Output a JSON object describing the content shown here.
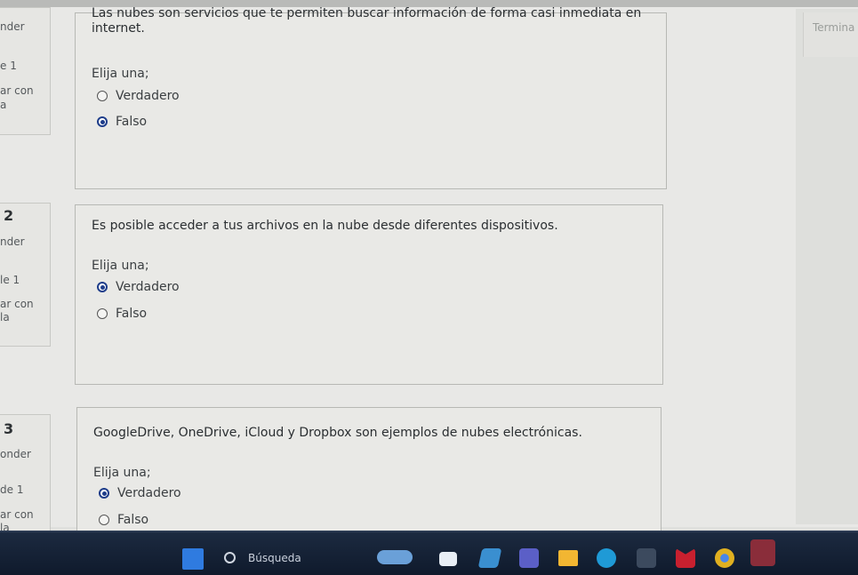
{
  "header": {
    "finish_label": "Termina"
  },
  "questions": [
    {
      "info": {
        "number": "",
        "state": "nder",
        "mark": "e 1",
        "flag": "ar con",
        "flag2": "a"
      },
      "text": "Las nubes son servicios que te permiten buscar información de forma casi inmediata en internet.",
      "prompt": "Elija una;",
      "options": [
        {
          "label": "Verdadero",
          "checked": false
        },
        {
          "label": "Falso",
          "checked": true
        }
      ]
    },
    {
      "info": {
        "number": "2",
        "state": "nder",
        "mark": "le 1",
        "flag": "ar con",
        "flag2": "la"
      },
      "text": "Es posible acceder a tus archivos en la nube desde diferentes dispositivos.",
      "prompt": "Elija una;",
      "options": [
        {
          "label": "Verdadero",
          "checked": true
        },
        {
          "label": "Falso",
          "checked": false
        }
      ]
    },
    {
      "info": {
        "number": "3",
        "state": "onder",
        "mark": "de 1",
        "flag": "ar con",
        "flag2": "la"
      },
      "text": "GoogleDrive, OneDrive, iCloud y Dropbox son ejemplos de nubes electrónicas.",
      "prompt": "Elija una;",
      "options": [
        {
          "label": "Verdadero",
          "checked": true
        },
        {
          "label": "Falso",
          "checked": false
        }
      ]
    }
  ],
  "taskbar": {
    "search_label": "Búsqueda",
    "icons": [
      {
        "name": "start-icon",
        "color": "#2f7be0"
      },
      {
        "name": "widgets-icon",
        "color": "#6aa0d8"
      },
      {
        "name": "file-icon",
        "color": "#e8eef5"
      },
      {
        "name": "copilot-icon",
        "color": "#3a8fd0"
      },
      {
        "name": "teams-icon",
        "color": "#5b5fc7"
      },
      {
        "name": "file-explorer-icon",
        "color": "#f2b632"
      },
      {
        "name": "edge-icon",
        "color": "#1f9ad6"
      },
      {
        "name": "calculator-icon",
        "color": "#3c4a5e"
      },
      {
        "name": "mcafee-icon",
        "color": "#c8202f"
      },
      {
        "name": "chrome-icon",
        "color": "#e0b020"
      },
      {
        "name": "word-icon",
        "color": "#8a2d3a"
      }
    ]
  }
}
